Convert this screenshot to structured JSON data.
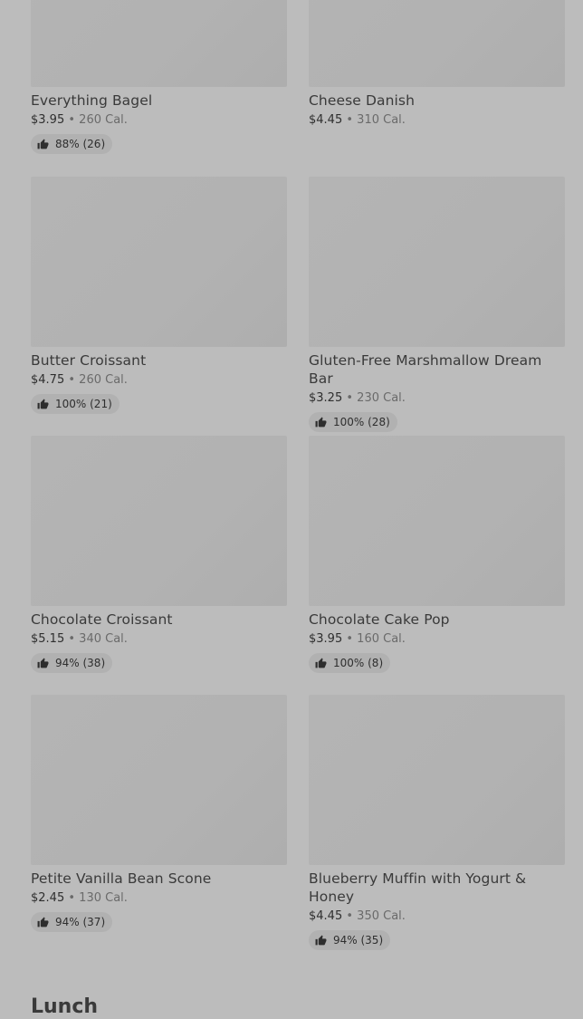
{
  "items": [
    {
      "name": "Everything Bagel",
      "price": "$3.95",
      "cal": "260 Cal.",
      "rating": "88% (26)"
    },
    {
      "name": "Cheese Danish",
      "price": "$4.45",
      "cal": "310 Cal.",
      "rating": ""
    },
    {
      "name": "Butter Croissant",
      "price": "$4.75",
      "cal": "260 Cal.",
      "rating": "100% (21)"
    },
    {
      "name": "Gluten-Free Marshmallow Dream Bar",
      "price": "$3.25",
      "cal": "230 Cal.",
      "rating": "100% (28)"
    },
    {
      "name": "Chocolate Croissant",
      "price": "$5.15",
      "cal": "340 Cal.",
      "rating": "94% (38)"
    },
    {
      "name": "Chocolate Cake Pop",
      "price": "$3.95",
      "cal": "160 Cal.",
      "rating": "100% (8)"
    },
    {
      "name": "Petite Vanilla Bean Scone",
      "price": "$2.45",
      "cal": "130 Cal.",
      "rating": "94% (37)"
    },
    {
      "name": "Blueberry Muffin with Yogurt & Honey",
      "price": "$4.45",
      "cal": "350 Cal.",
      "rating": "94% (35)"
    }
  ],
  "separator": "•",
  "next_section": {
    "title": "Lunch"
  },
  "icons": {
    "rating": "thumbs-up-icon"
  }
}
